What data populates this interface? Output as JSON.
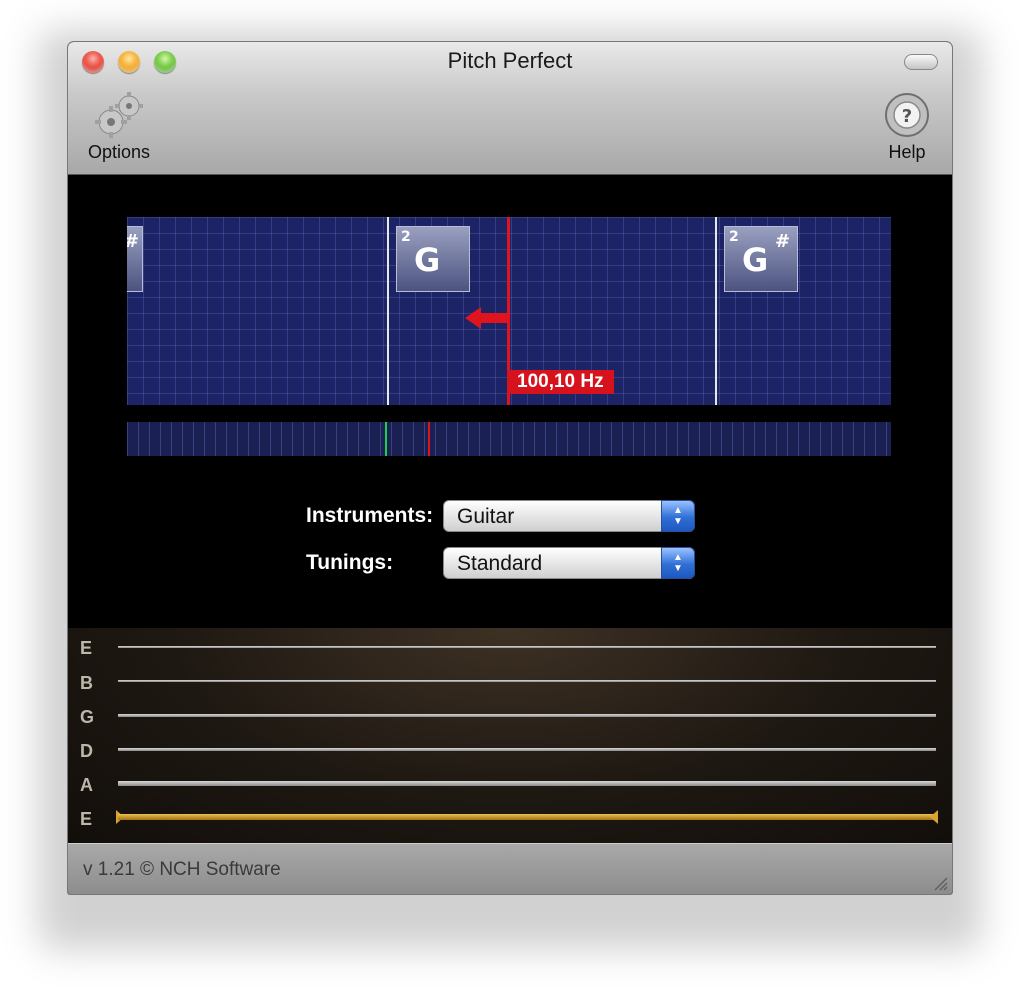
{
  "window": {
    "title": "Pitch Perfect"
  },
  "toolbar": {
    "options": {
      "label": "Options",
      "icon": "gears-icon"
    },
    "help": {
      "label": "Help",
      "icon": "help-icon"
    }
  },
  "tuner": {
    "left_note_fragment": "#",
    "notes": [
      {
        "octave": "2",
        "name": "G",
        "sharp": ""
      },
      {
        "octave": "2",
        "name": "G",
        "sharp": "#"
      }
    ],
    "frequency": "100,10 Hz",
    "direction": "left",
    "accent_color": "#d6121c",
    "grid_color": "#1d2466"
  },
  "controls": {
    "instruments": {
      "label": "Instruments:",
      "value": "Guitar"
    },
    "tunings": {
      "label": "Tunings:",
      "value": "Standard"
    }
  },
  "strings": [
    {
      "name": "E",
      "active": false
    },
    {
      "name": "B",
      "active": false
    },
    {
      "name": "G",
      "active": false
    },
    {
      "name": "D",
      "active": false
    },
    {
      "name": "A",
      "active": false
    },
    {
      "name": "E",
      "active": true
    }
  ],
  "status": {
    "text": "v 1.21 © NCH Software"
  }
}
